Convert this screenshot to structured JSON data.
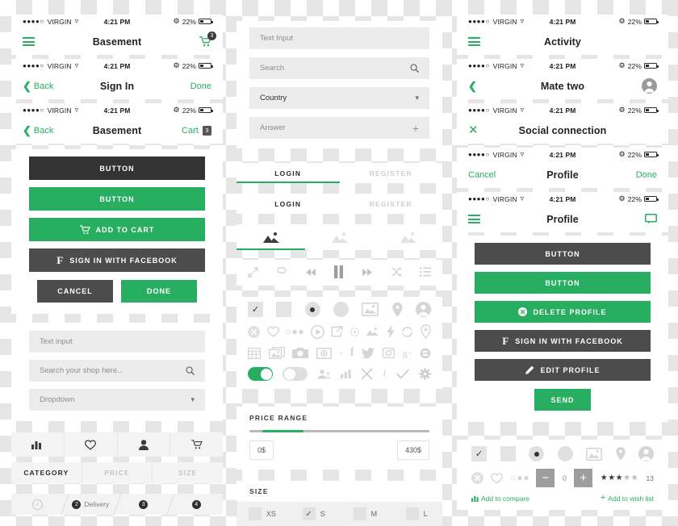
{
  "theme": {
    "green": "#27ae60",
    "dark": "#333333",
    "grey_dark": "#4c4c4c",
    "field_bg": "#ececec",
    "icon_grey": "#d5d5d5"
  },
  "statusbar": {
    "carrier": "VIRGIN",
    "dots": "●●●●○",
    "time": "4:21 PM",
    "battery_percent": "22%",
    "wifi_icon": "wifi-icon",
    "bluetooth_icon": "bluetooth-icon",
    "battery_icon": "battery-icon"
  },
  "left_column": {
    "navbars": [
      {
        "left_icon": "hamburger-icon",
        "title": "Basement",
        "right_icon": "cart-icon",
        "cart_badge": "3"
      },
      {
        "back_label": "Back",
        "title": "Sign In",
        "right_label": "Done"
      },
      {
        "back_label": "Back",
        "title": "Basement",
        "right_label": "Cart",
        "cart_badge": "3"
      }
    ],
    "buttons": [
      {
        "label": "BUTTON",
        "style": "dark"
      },
      {
        "label": "BUTTON",
        "style": "green"
      },
      {
        "label": "ADD TO CART",
        "style": "green",
        "icon": "cart-icon"
      },
      {
        "label": "SIGN IN WITH FACEBOOK",
        "style": "grey",
        "icon": "facebook-icon"
      }
    ],
    "cancel_label": "CANCEL",
    "done_label": "DONE",
    "fields": [
      {
        "placeholder": "Text input",
        "icon": ""
      },
      {
        "placeholder": "Search your shop here...",
        "icon": "search-icon"
      },
      {
        "placeholder": "Dropdown",
        "icon": "chevron-down-icon"
      }
    ],
    "tabbar_icons": [
      "chart-bar-icon",
      "heart-icon",
      "person-icon",
      "cart-icon"
    ],
    "filters": [
      "CATEGORY",
      "PRICE",
      "SIZE"
    ],
    "steps": [
      {
        "num": "✓",
        "label": "",
        "state": "done"
      },
      {
        "num": "2",
        "label": "Delivery",
        "state": "active"
      },
      {
        "num": "3",
        "label": "",
        "state": "active"
      },
      {
        "num": "4",
        "label": "",
        "state": "active"
      }
    ]
  },
  "mid_column": {
    "fields": [
      {
        "value": "Text Input",
        "filled": false,
        "icon": ""
      },
      {
        "value": "Search",
        "filled": false,
        "icon": "search-icon"
      },
      {
        "value": "Country",
        "filled": true,
        "icon": "chevron-down-icon"
      },
      {
        "value": "Answer",
        "filled": false,
        "icon": "plus-icon"
      }
    ],
    "tabs_underlined": [
      {
        "label": "LOGIN",
        "active": true
      },
      {
        "label": "REGISTER",
        "active": false
      }
    ],
    "tabs_plain": [
      {
        "label": "LOGIN",
        "active": true
      },
      {
        "label": "REGISTER",
        "active": false
      }
    ],
    "gallery_tabs": [
      {
        "icon": "image-icon",
        "active": true
      },
      {
        "icon": "image-icon",
        "active": false
      },
      {
        "icon": "image-icon",
        "active": false
      }
    ],
    "player_icons": [
      "expand-icon",
      "repeat-icon",
      "rewind-icon",
      "pause-icon",
      "forward-icon",
      "shuffle-icon",
      "playlist-icon"
    ],
    "icon_grid_row1": [
      "checkbox-checked-icon",
      "checkbox-empty-icon",
      "radio-selected-icon",
      "radio-empty-icon",
      "image-icon",
      "map-pin-icon",
      "avatar-icon"
    ],
    "icon_grid_row2": [
      "close-circle-icon",
      "heart-icon",
      "dots-icon",
      "play-circle-icon",
      "share-icon",
      "record-icon",
      "image-small-icon",
      "flash-icon",
      "refresh-icon",
      "pin-download-icon"
    ],
    "icon_grid_row3": [
      "grid-icon",
      "gallery-icon",
      "camera-icon",
      "video-icon",
      "chevron-right-icon",
      "facebook-icon",
      "twitter-icon",
      "instagram-icon",
      "googleplus-icon",
      "blogger-icon"
    ],
    "icon_grid_row4": [
      "toggle-on-icon",
      "toggle-off-icon",
      "group-icon",
      "bars-icon",
      "close-icon",
      "info-icon",
      "check-icon",
      "gear-icon"
    ],
    "price_range": {
      "title": "PRICE RANGE",
      "min_label": "0$",
      "max_label": "430$",
      "fill_start_percent": 7,
      "fill_end_percent": 30
    },
    "size": {
      "title": "SIZE",
      "options": [
        "XS",
        "S",
        "M",
        "L"
      ],
      "selected": "S"
    }
  },
  "right_column": {
    "navbars": [
      {
        "left_icon": "hamburger-icon",
        "title": "Activity",
        "right_icon": ""
      },
      {
        "left_icon": "chevron-left-icon",
        "title": "Mate two",
        "right_icon": "avatar-icon"
      },
      {
        "left_icon": "close-icon",
        "title": "Social connection",
        "right_icon": ""
      },
      {
        "left_label": "Cancel",
        "title": "Profile",
        "right_label": "Done"
      },
      {
        "left_icon": "hamburger-icon",
        "title": "Profile",
        "right_icon": "chat-icon"
      }
    ],
    "buttons": [
      {
        "label": "BUTTON",
        "style": "grey"
      },
      {
        "label": "BUTTON",
        "style": "green"
      },
      {
        "label": "DELETE PROFILE",
        "style": "green",
        "icon": "close-circle-icon"
      },
      {
        "label": "SIGN IN WITH FACEBOOK",
        "style": "grey",
        "icon": "facebook-icon"
      },
      {
        "label": "EDIT PROFILE",
        "style": "grey",
        "icon": "pencil-icon"
      }
    ],
    "send_label": "SEND",
    "icon_row1": [
      "checkbox-checked-icon",
      "checkbox-empty-icon",
      "radio-selected-icon",
      "radio-empty-icon",
      "image-icon",
      "map-pin-icon",
      "avatar-icon"
    ],
    "stepper": {
      "minus": "−",
      "value": "0",
      "plus": "+"
    },
    "rating": {
      "filled": 3,
      "total": 5,
      "count": "13"
    },
    "add_to_compare": "Add to compare",
    "add_to_wish_list": "Add to wish list"
  }
}
